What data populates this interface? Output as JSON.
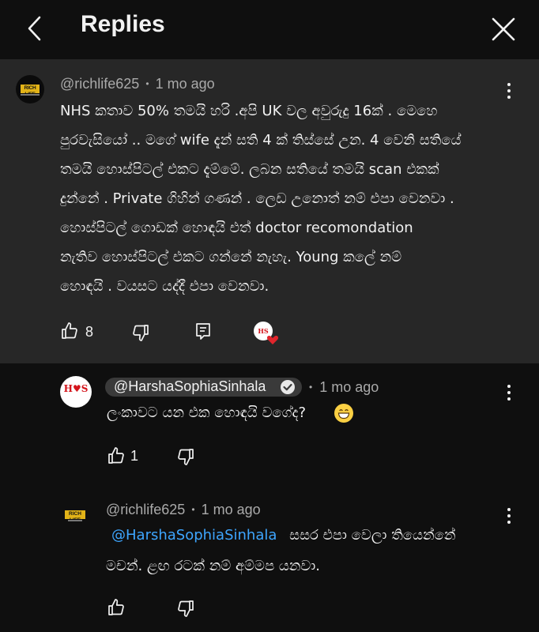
{
  "header": {
    "title": "Replies",
    "back_icon": "chevron-left-icon",
    "close_icon": "close-icon"
  },
  "parent_comment": {
    "author": "@richlife625",
    "time": "1 mo ago",
    "separator": "•",
    "avatar_text": "RICH LIFE",
    "lines": [
      "NHS කතාව 50% තමයි හරි .අපි UK  වල අවුරුදු 16ක් . මෙහෙ",
      "පුරවැසියෝ .. මගේ wife  දැන් සති 4 ක් තිස්සේ උන.  4 වෙනි සතියේ",
      "තමයි  හොස්පිටල් එකට දැම්මේ. ලබන සතියේ තමයි  scan  එකක්",
      "දුන්නේ . Private ගිහින්  ගණන් . ලෙඩ  උනොත්  නම් එපා  වෙනවා .",
      "හොස්පිටල් ගොඩක්  හොඳයි එත් doctor  recomondation",
      "නැතිව හොස්පිටල් එකට ගන්නේ නැහැ. Young  කලේ නම්",
      "හොඳයි . වයසට යද්දී එපා වෙනවා."
    ],
    "likes": "8"
  },
  "reply_1": {
    "author": "@HarshaSophiaSinhala",
    "time": "1 mo ago",
    "separator": "•",
    "avatar_text": "H♥S",
    "text": "ලංකාවට යන එක හොඳයි වගේද?",
    "likes": "1"
  },
  "reply_2": {
    "author": "@richlife625",
    "time": "1 mo ago",
    "separator": "•",
    "avatar_text": "RICH LIFE",
    "mention": "@HarshaSophiaSinhala",
    "line1_rest": "සසර එපා වෙලා තියෙන්නේ",
    "line2": "මචන්. ළඟ  රටක් නම් අම්මප යනවා."
  },
  "colors": {
    "background": "#0f0f0f",
    "highlight": "#272727",
    "text": "#f1f1f1",
    "meta": "#aaaaaa",
    "mention": "#3ea6ff",
    "heart": "#e0252c"
  }
}
